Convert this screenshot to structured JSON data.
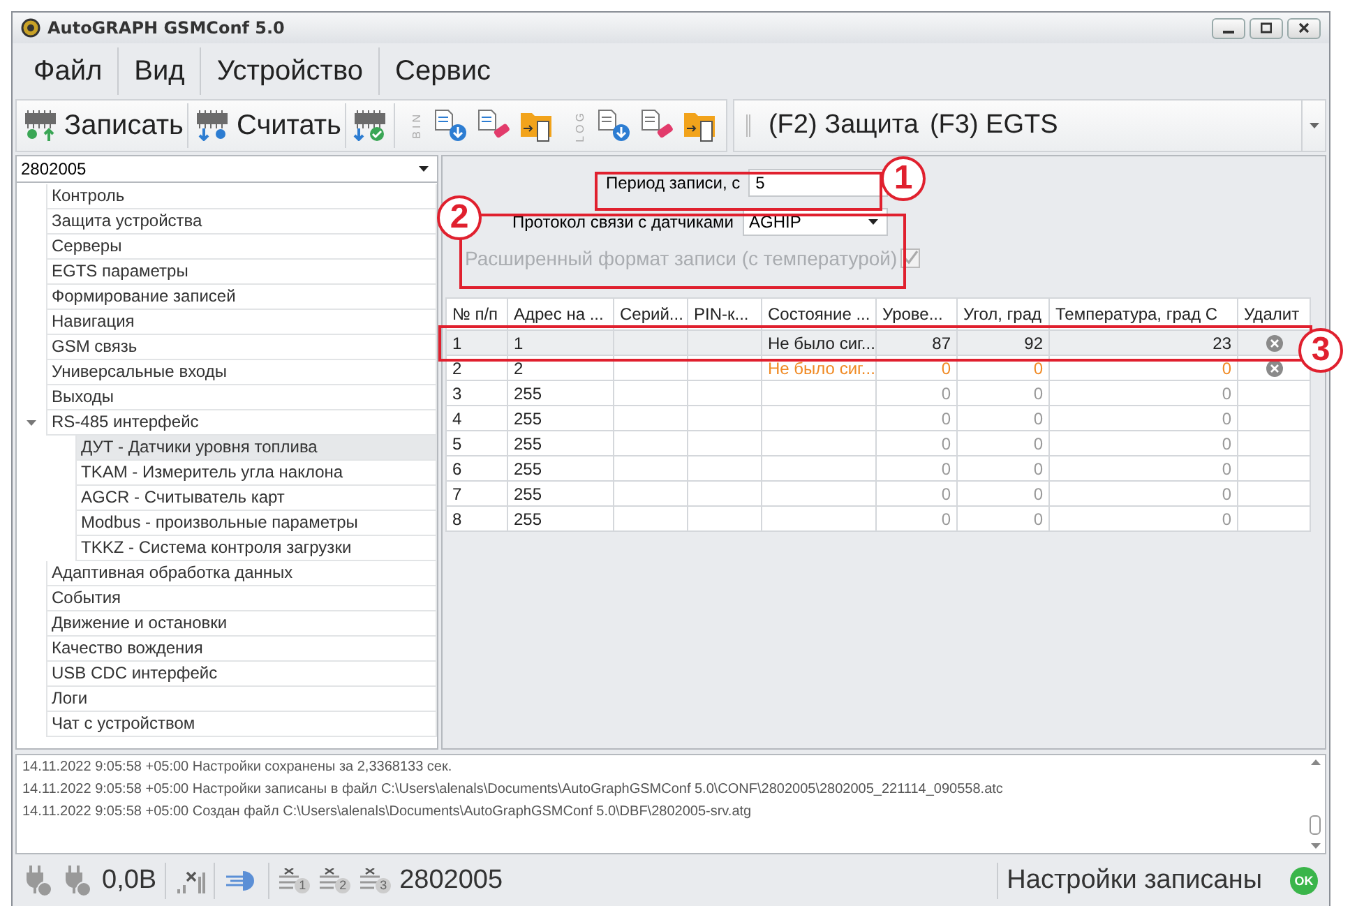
{
  "window": {
    "title": "AutoGRAPH GSMConf 5.0"
  },
  "menu": [
    "Файл",
    "Вид",
    "Устройство",
    "Сервис"
  ],
  "toolbar": {
    "write": "Записать",
    "read": "Считать",
    "bin_label": "BIN",
    "log_label": "LOG",
    "tabs": [
      {
        "label": "(F2) Защита"
      },
      {
        "label": "(F3) EGTS"
      }
    ]
  },
  "device_select": {
    "value": "2802005"
  },
  "tree": [
    {
      "label": "Контроль",
      "selected": false
    },
    {
      "label": "Защита устройства",
      "selected": false
    },
    {
      "label": "Серверы",
      "selected": false
    },
    {
      "label": "EGTS параметры",
      "selected": false
    },
    {
      "label": "Формирование записей",
      "selected": false
    },
    {
      "label": "Навигация",
      "selected": false
    },
    {
      "label": "GSM связь",
      "selected": false
    },
    {
      "label": "Универсальные входы",
      "selected": false
    },
    {
      "label": "Выходы",
      "selected": false
    },
    {
      "label": "RS-485 интерфейс",
      "selected": false,
      "expanded": true,
      "children": [
        {
          "label": "ДУТ - Датчики уровня топлива",
          "selected": true
        },
        {
          "label": "TKAM - Измеритель угла наклона",
          "selected": false
        },
        {
          "label": "AGCR - Считыватель карт",
          "selected": false
        },
        {
          "label": "Modbus - произвольные параметры",
          "selected": false
        },
        {
          "label": "TKKZ - Система контроля загрузки",
          "selected": false
        }
      ]
    },
    {
      "label": "Адаптивная обработка данных",
      "selected": false
    },
    {
      "label": "События",
      "selected": false
    },
    {
      "label": "Движение и остановки",
      "selected": false
    },
    {
      "label": "Качество вождения",
      "selected": false
    },
    {
      "label": "USB CDC интерфейс",
      "selected": false
    },
    {
      "label": "Логи",
      "selected": false
    },
    {
      "label": "Чат с устройством",
      "selected": false
    }
  ],
  "settings": {
    "period_label": "Период записи, с",
    "period_value": "5",
    "protocol_label": "Протокол связи с датчиками",
    "protocol_value": "AGHIP",
    "extended_label": "Расширенный формат записи (с температурой)",
    "extended_checked": true,
    "extended_disabled": true
  },
  "table": {
    "columns": [
      "№ п/п",
      "Адрес на ...",
      "Серий...",
      "PIN-к...",
      "Состояние ...",
      "Урове...",
      "Угол, град",
      "Температура, град С",
      "Удалит"
    ],
    "rows": [
      {
        "number": "1",
        "address": "1",
        "status": "Не было сиг...",
        "level": "87",
        "angle": "92",
        "temperature": "23",
        "kind": "normal",
        "selected": true,
        "deletable": true
      },
      {
        "number": "2",
        "address": "2",
        "status": "Не было сиг...",
        "level": "0",
        "angle": "0",
        "temperature": "0",
        "kind": "alert",
        "selected": false,
        "deletable": true
      },
      {
        "number": "3",
        "address": "255",
        "level": "0",
        "angle": "0",
        "temperature": "0",
        "kind": "inactive",
        "selected": false,
        "deletable": false
      },
      {
        "number": "4",
        "address": "255",
        "level": "0",
        "angle": "0",
        "temperature": "0",
        "kind": "inactive",
        "selected": false,
        "deletable": false
      },
      {
        "number": "5",
        "address": "255",
        "level": "0",
        "angle": "0",
        "temperature": "0",
        "kind": "inactive",
        "selected": false,
        "deletable": false
      },
      {
        "number": "6",
        "address": "255",
        "level": "0",
        "angle": "0",
        "temperature": "0",
        "kind": "inactive",
        "selected": false,
        "deletable": false
      },
      {
        "number": "7",
        "address": "255",
        "level": "0",
        "angle": "0",
        "temperature": "0",
        "kind": "inactive",
        "selected": false,
        "deletable": false
      },
      {
        "number": "8",
        "address": "255",
        "level": "0",
        "angle": "0",
        "temperature": "0",
        "kind": "inactive",
        "selected": false,
        "deletable": false
      }
    ]
  },
  "callouts": [
    "1",
    "2",
    "3"
  ],
  "log": [
    "14.11.2022 9:05:58 +05:00 Настройки сохранены за 2,3368133 сек.",
    "14.11.2022 9:05:58 +05:00 Настройки записаны в файл C:\\Users\\alenals\\Documents\\AutoGraphGSMConf 5.0\\CONF\\2802005\\2802005_221114_090558.atc",
    "14.11.2022 9:05:58 +05:00 Создан файл C:\\Users\\alenals\\Documents\\AutoGraphGSMConf 5.0\\DBF\\2802005-srv.atg"
  ],
  "status_bar": {
    "voltage": "0,0В",
    "sim_slots": [
      "1",
      "2",
      "3"
    ],
    "device_id": "2802005",
    "message": "Настройки записаны",
    "ok_badge": "OK"
  }
}
